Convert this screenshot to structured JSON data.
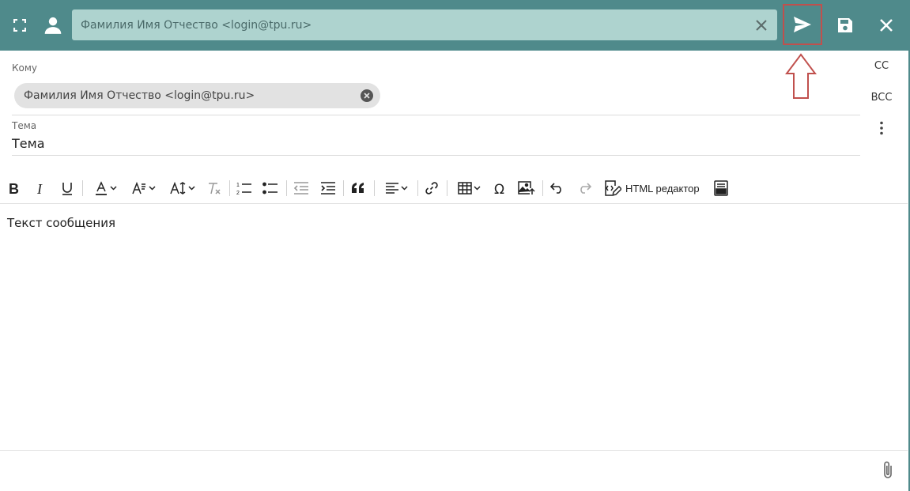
{
  "header": {
    "from_value": "Фамилия Имя Отчество <login@tpu.ru>",
    "icons": [
      "fullscreen-icon",
      "user-icon",
      "clear-icon",
      "send-icon",
      "save-icon",
      "close-icon"
    ]
  },
  "recipients": {
    "to_label": "Кому",
    "to_chip": "Фамилия Имя Отчество <login@tpu.ru>",
    "cc_label": "CC",
    "bcc_label": "BCC"
  },
  "subject": {
    "label": "Тема",
    "value": "Тема"
  },
  "toolbar": {
    "html_editor_label": "HTML редактор"
  },
  "message": {
    "body": "Текст сообщения"
  },
  "colors": {
    "header": "#4f8a8b",
    "from_field": "#aed3cf",
    "annotation": "#c0504d"
  }
}
